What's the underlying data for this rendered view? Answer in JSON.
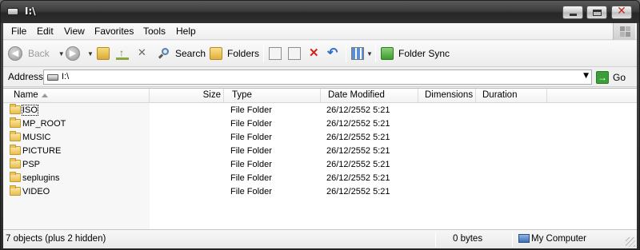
{
  "window": {
    "title": "I:\\"
  },
  "menu": [
    "File",
    "Edit",
    "View",
    "Favorites",
    "Tools",
    "Help"
  ],
  "toolbar": {
    "back": "Back",
    "search": "Search",
    "folders": "Folders",
    "folder_sync": "Folder Sync"
  },
  "address": {
    "label": "Address",
    "value": "I:\\",
    "go": "Go"
  },
  "columns": [
    "Name",
    "Size",
    "Type",
    "Date Modified",
    "Dimensions",
    "Duration"
  ],
  "rows": [
    {
      "name": "ISO",
      "type": "File Folder",
      "date": "26/12/2552 5:21"
    },
    {
      "name": "MP_ROOT",
      "type": "File Folder",
      "date": "26/12/2552 5:21"
    },
    {
      "name": "MUSIC",
      "type": "File Folder",
      "date": "26/12/2552 5:21"
    },
    {
      "name": "PICTURE",
      "type": "File Folder",
      "date": "26/12/2552 5:21"
    },
    {
      "name": "PSP",
      "type": "File Folder",
      "date": "26/12/2552 5:21"
    },
    {
      "name": "seplugins",
      "type": "File Folder",
      "date": "26/12/2552 5:21"
    },
    {
      "name": "VIDEO",
      "type": "File Folder",
      "date": "26/12/2552 5:21"
    }
  ],
  "status": {
    "objects": "7 objects (plus 2 hidden)",
    "size": "0 bytes",
    "location": "My Computer"
  }
}
